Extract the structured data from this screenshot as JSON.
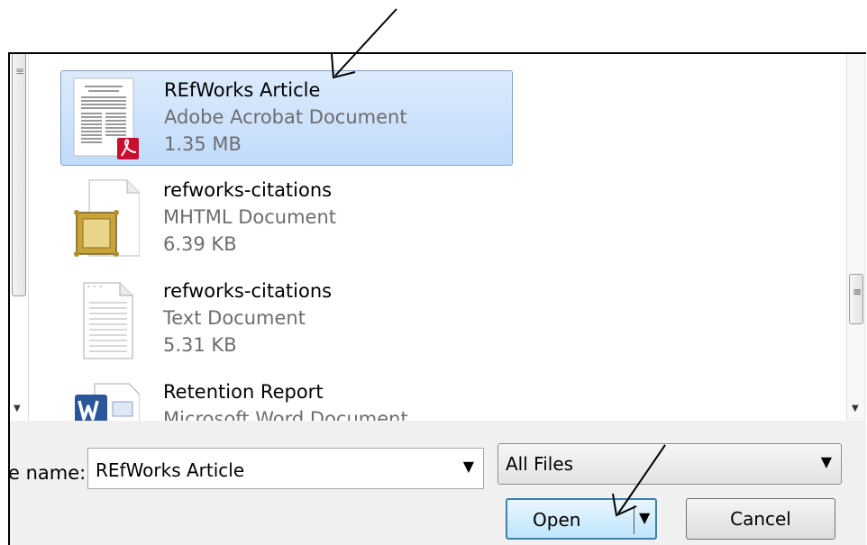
{
  "files": [
    {
      "name": "REfWorks Article",
      "type": "Adobe Acrobat Document",
      "size": "1.35 MB",
      "icon": "pdf-document-icon",
      "selected": true
    },
    {
      "name": "refworks-citations",
      "type": "MHTML Document",
      "size": "6.39 KB",
      "icon": "mhtml-document-icon",
      "selected": false
    },
    {
      "name": "refworks-citations",
      "type": "Text Document",
      "size": "5.31 KB",
      "icon": "text-document-icon",
      "selected": false
    },
    {
      "name": "Retention Report",
      "type": "Microsoft Word Document",
      "size": "",
      "icon": "word-document-icon",
      "selected": false
    }
  ],
  "file_name": {
    "label": "e name:",
    "value": "REfWorks Article"
  },
  "file_type_filter": {
    "value": "All Files"
  },
  "buttons": {
    "open": "Open",
    "cancel": "Cancel"
  },
  "colors": {
    "selection": "#c1dbfc",
    "selection_border": "#7da2ce",
    "pdf_red": "#c8102e",
    "word_blue": "#2b579a"
  }
}
